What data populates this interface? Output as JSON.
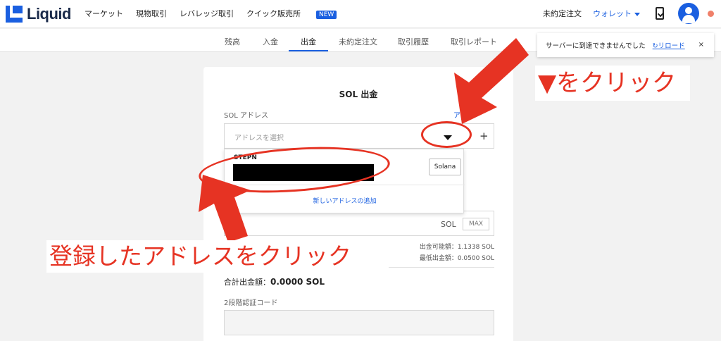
{
  "brand": {
    "name": "Liquid"
  },
  "nav": {
    "items": [
      "マーケット",
      "現物取引",
      "レバレッジ取引",
      "クイック販売所"
    ],
    "new_badge": "NEW",
    "pending_orders": "未約定注文",
    "wallet": "ウォレット"
  },
  "tabs": [
    "残高",
    "入金",
    "出金",
    "未約定注文",
    "取引履歴",
    "取引レポート"
  ],
  "active_tab": "出金",
  "toast": {
    "message": "サーバーに到達できませんでした",
    "reload": "リロード",
    "close": "×"
  },
  "form": {
    "title": "SOL 出金",
    "address_label": "SOL アドレス",
    "address_link": "ア",
    "address_placeholder": "アドレスを選択",
    "amount_unit": "SOL",
    "max_label": "MAX",
    "available": "出金可能額：1.1338 SOL",
    "minimum": "最低出金額：0.0500 SOL",
    "total_label": "合計出金額：",
    "total_value": "0.0000 SOL",
    "tfa_label": "2段階認証コード"
  },
  "dropdown": {
    "entry_name": "STEPN",
    "network_chip": "Solana",
    "add_new": "新しいアドレスの追加"
  },
  "annotations": {
    "right": "▼をクリック",
    "left": "登録したアドレスをクリック"
  },
  "colors": {
    "accent": "#1a5fe0",
    "annotation": "#e63323"
  }
}
